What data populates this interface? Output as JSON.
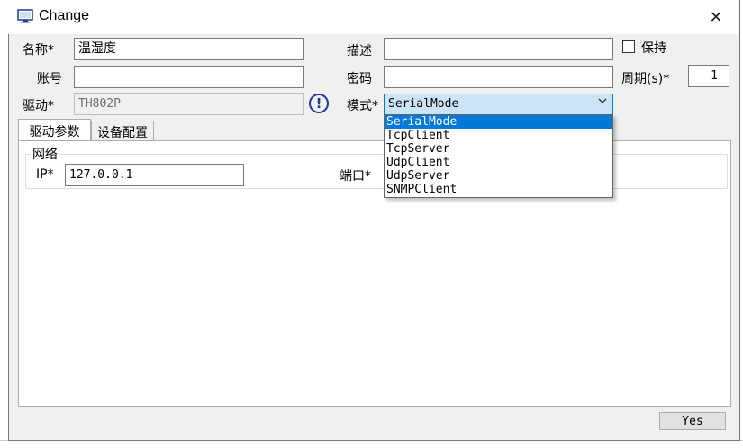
{
  "window": {
    "title": "Change",
    "close_glyph": "✕"
  },
  "form": {
    "name_label": "名称*",
    "name_value": "温湿度",
    "desc_label": "描述",
    "desc_value": "",
    "keep_label": "保持",
    "keep_checked": false,
    "account_label": "账号",
    "account_value": "",
    "password_label": "密码",
    "password_value": "",
    "period_label": "周期(s)*",
    "period_value": "1",
    "driver_label": "驱动*",
    "driver_value": "TH802P",
    "mode_label": "模式*",
    "mode_value": "SerialMode",
    "mode_options": [
      "SerialMode",
      "TcpClient",
      "TcpServer",
      "UdpClient",
      "UdpServer",
      "SNMPClient"
    ]
  },
  "tabs": [
    {
      "label": "驱动参数"
    },
    {
      "label": "设备配置"
    }
  ],
  "network_group": {
    "title": "网络",
    "ip_label": "IP*",
    "ip_value": "127.0.0.1",
    "port_label": "端口*"
  },
  "footer": {
    "yes_label": "Yes"
  },
  "icons": {
    "app": "computer-icon",
    "warning": "exclamation-icon",
    "dropdown": "chevron-down-icon",
    "close": "close-icon"
  },
  "colors": {
    "selection": "#0078d7",
    "select_bg": "#cce4f7",
    "warning": "#1f3a93"
  }
}
